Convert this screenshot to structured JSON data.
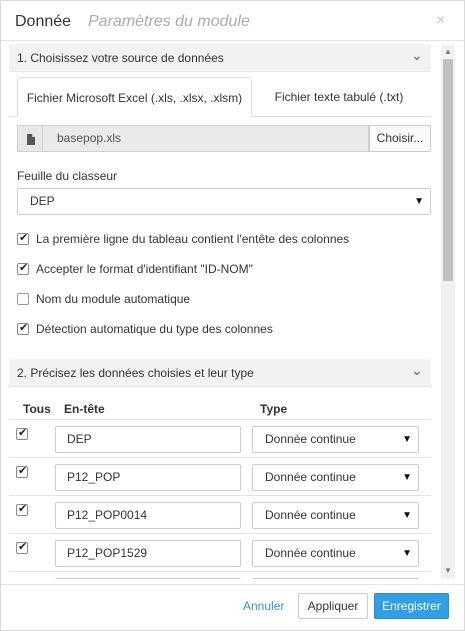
{
  "header": {
    "title": "Donnée",
    "subtitle": "Paramètres du module",
    "close": "×"
  },
  "section1": {
    "label": "1. Choisissez votre source de données",
    "tabs": [
      {
        "label": "Fichier Microsoft Excel (.xls, .xlsx, .xlsm)",
        "active": true
      },
      {
        "label": "Fichier texte tabulé (.txt)",
        "active": false
      }
    ],
    "file": {
      "name": "basepop.xls",
      "browse_label": "Choisir..."
    },
    "sheet_label": "Feuille du classeur",
    "sheet_value": "DEP",
    "checkboxes": [
      {
        "label": "La première ligne du tableau contient l'entête des colonnes",
        "checked": true
      },
      {
        "label": "Accepter le format d'identifiant \"ID-NOM\"",
        "checked": true
      },
      {
        "label": "Nom du module automatique",
        "checked": false
      },
      {
        "label": "Détection automatique du type des colonnes",
        "checked": true
      }
    ]
  },
  "section2": {
    "label": "2. Précisez les données choisies et leur type",
    "columns": {
      "all": "Tous",
      "header": "En-tête",
      "type": "Type"
    },
    "rows": [
      {
        "name": "DEP",
        "type": "Donnée continue",
        "checked": true
      },
      {
        "name": "P12_POP",
        "type": "Donnée continue",
        "checked": true
      },
      {
        "name": "P12_POP0014",
        "type": "Donnée continue",
        "checked": true
      },
      {
        "name": "P12_POP1529",
        "type": "Donnée continue",
        "checked": true
      },
      {
        "name": "",
        "type": "",
        "checked": true
      }
    ]
  },
  "footer": {
    "cancel": "Annuler",
    "apply": "Appliquer",
    "save": "Enregistrer"
  },
  "colors": {
    "accent": "#31a0e3",
    "link": "#3a8fd6"
  }
}
